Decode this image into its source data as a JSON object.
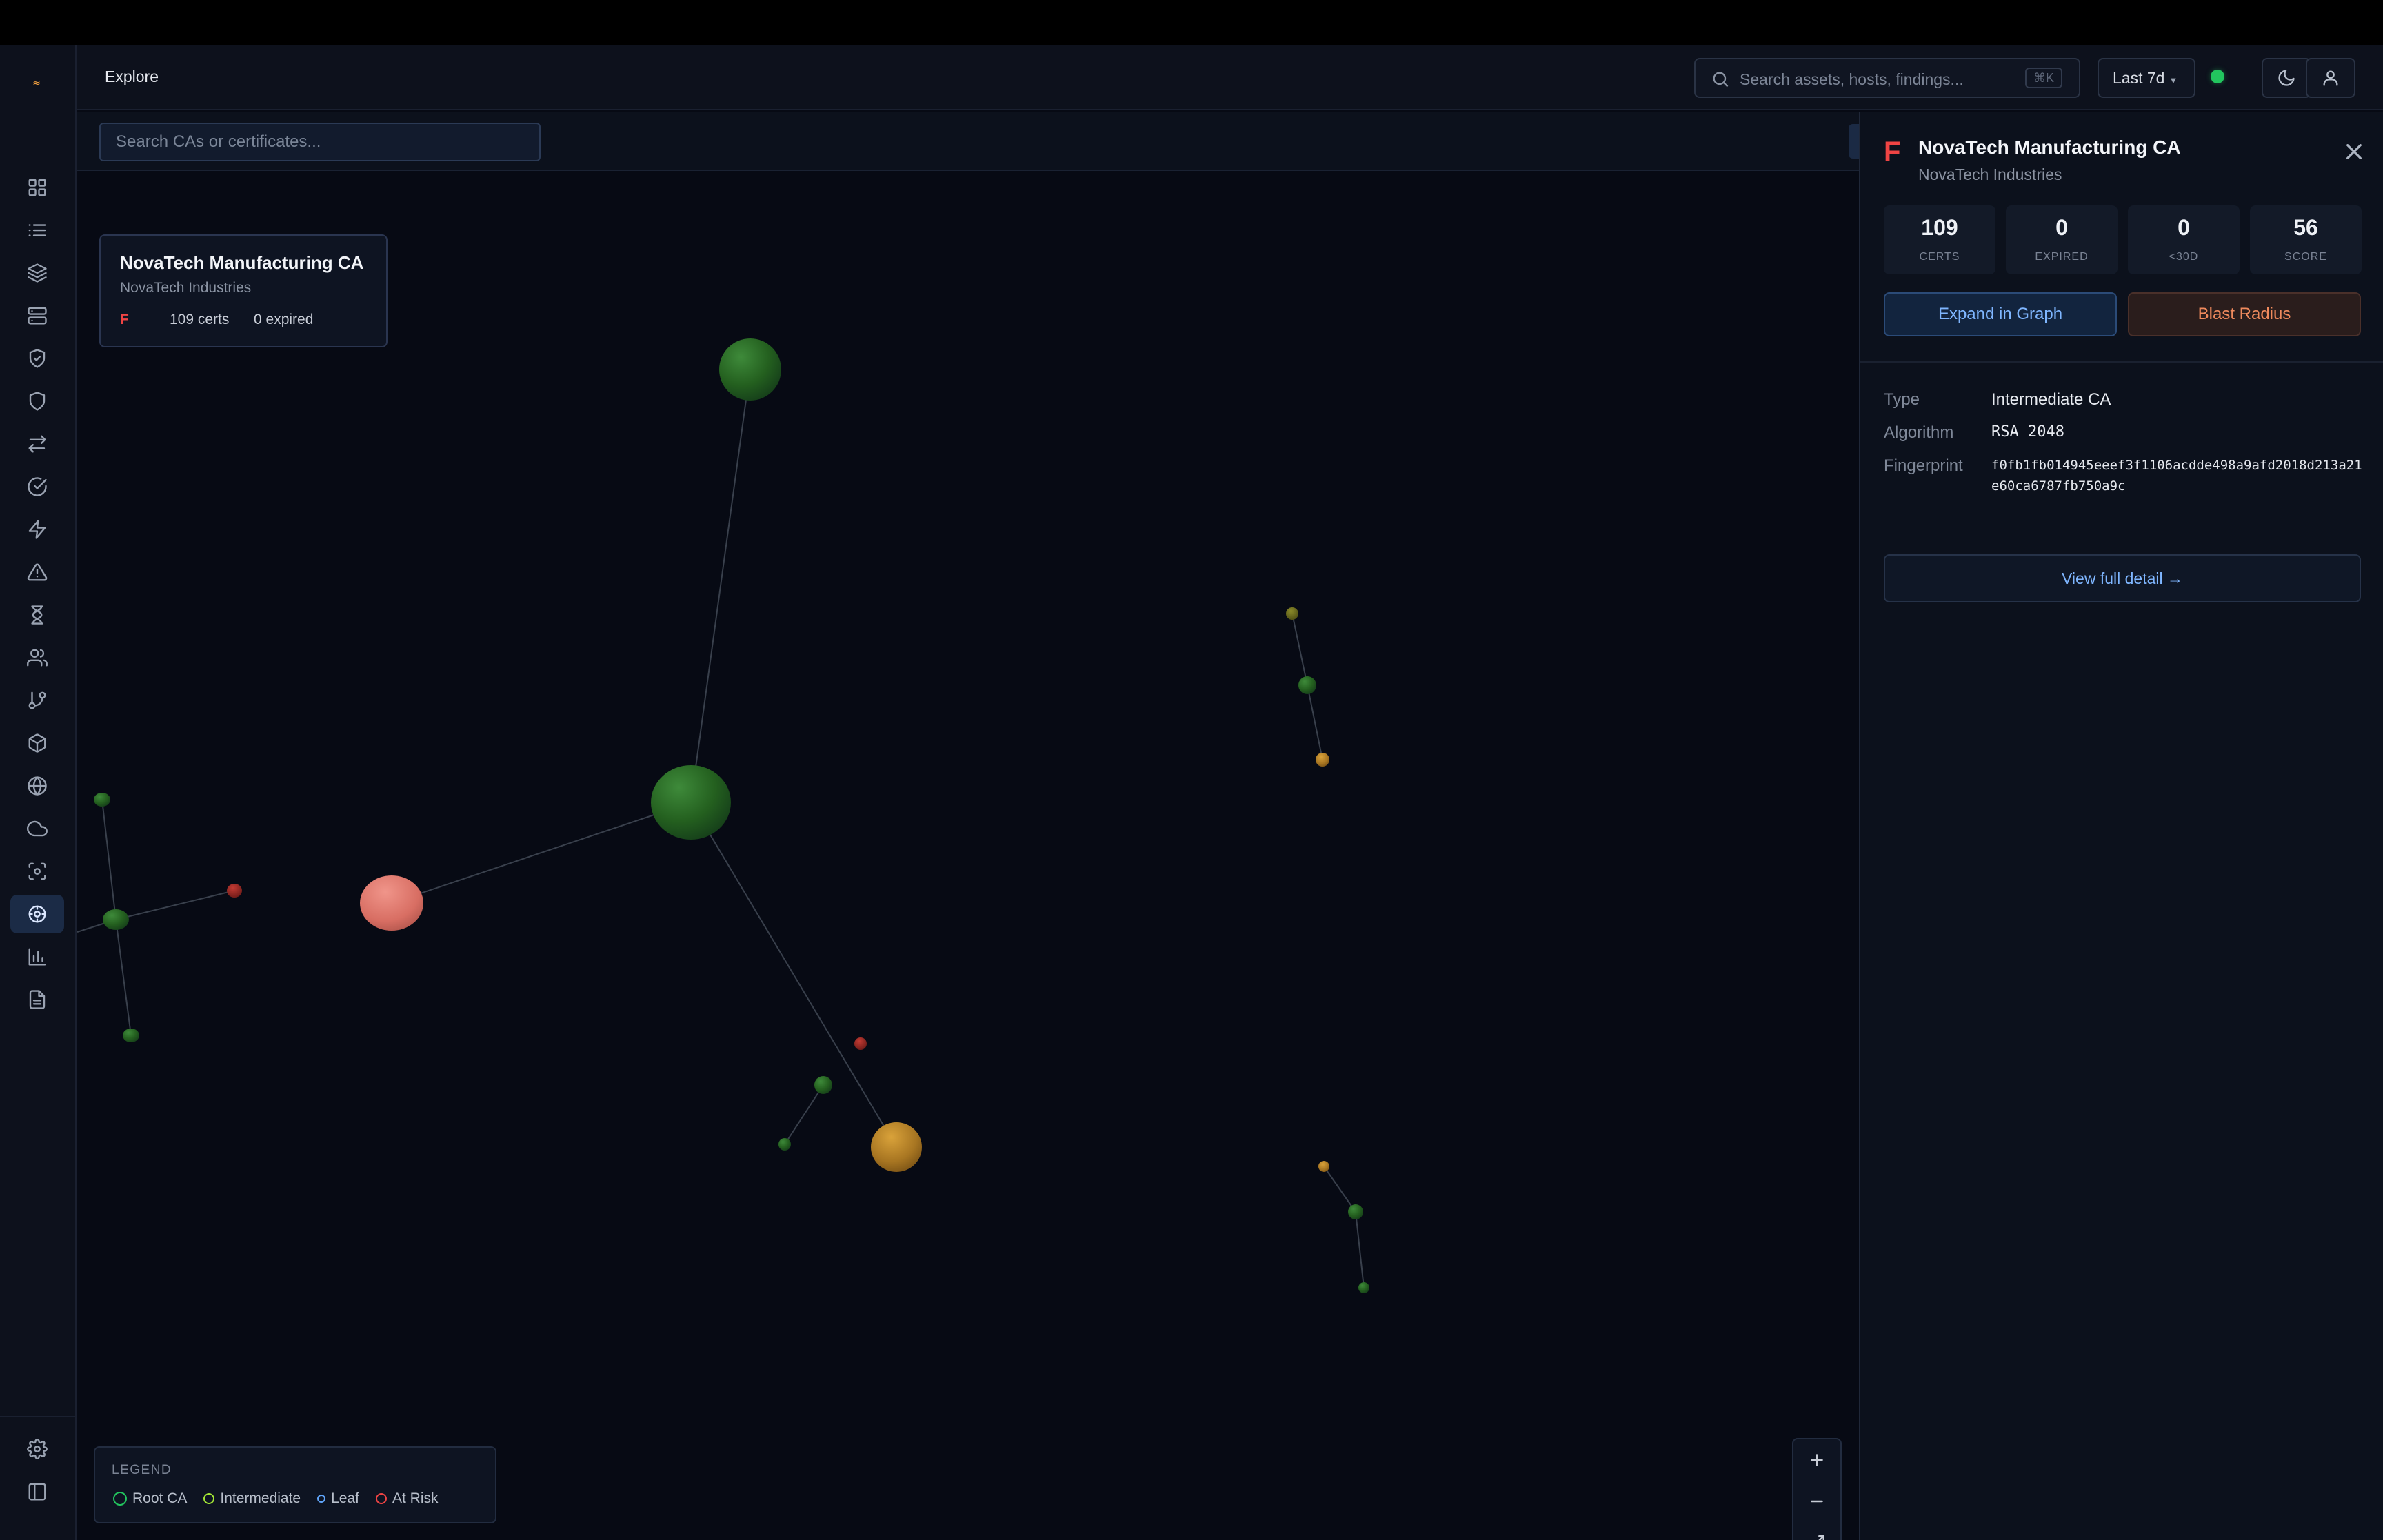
{
  "topbar": {
    "title": "Explore",
    "search_placeholder": "Search assets, hosts, findings...",
    "search_shortcut": "⌘K",
    "time_range": "Last 7d",
    "status_color": "#22c55e"
  },
  "sidebar": {
    "logo": "≈",
    "items": [
      {
        "icon": "dashboard-grid-icon"
      },
      {
        "icon": "list-icon"
      },
      {
        "icon": "layers-icon"
      },
      {
        "icon": "server-icon"
      },
      {
        "icon": "shield-check-icon"
      },
      {
        "icon": "shield-icon"
      },
      {
        "icon": "arrows-swap-icon"
      },
      {
        "icon": "check-circle-icon"
      },
      {
        "icon": "lightning-icon"
      },
      {
        "icon": "warning-triangle-icon"
      },
      {
        "icon": "hourglass-icon"
      },
      {
        "icon": "users-icon"
      },
      {
        "icon": "git-branch-icon"
      },
      {
        "icon": "package-box-icon"
      },
      {
        "icon": "globe-icon"
      },
      {
        "icon": "cloud-icon"
      },
      {
        "icon": "scan-icon"
      },
      {
        "icon": "certificate-graph-icon",
        "active": true
      },
      {
        "icon": "bar-chart-icon"
      },
      {
        "icon": "document-icon"
      }
    ],
    "bottom": [
      {
        "icon": "gear-icon"
      },
      {
        "icon": "sidebar-toggle-icon"
      }
    ]
  },
  "canvas": {
    "search_placeholder": "Search CAs or certificates...",
    "selected": {
      "name": "NovaTech Manufacturing CA",
      "org": "NovaTech Industries",
      "grade": "F",
      "certs": "109 certs",
      "expired": "0 expired"
    },
    "legend": {
      "title": "LEGEND",
      "items": [
        {
          "label": "Root CA",
          "color": "#22c55e"
        },
        {
          "label": "Intermediate",
          "color": "#a3e635"
        },
        {
          "label": "Leaf",
          "color": "#60a5fa"
        },
        {
          "label": "At Risk",
          "color": "#ef4444"
        }
      ]
    },
    "zoom": [
      "zoom-in",
      "zoom-out",
      "fit-screen"
    ]
  },
  "panel": {
    "grade": "F",
    "name": "NovaTech Manufacturing CA",
    "org": "NovaTech Industries",
    "stats": [
      {
        "value": "109",
        "label": "CERTS"
      },
      {
        "value": "0",
        "label": "EXPIRED"
      },
      {
        "value": "0",
        "label": "<30D"
      },
      {
        "value": "56",
        "label": "SCORE"
      }
    ],
    "expand_label": "Expand in Graph",
    "blast_label": "Blast Radius",
    "fields": {
      "type_key": "Type",
      "type_value": "Intermediate CA",
      "algo_key": "Algorithm",
      "algo_value": "RSA 2048",
      "fp_key": "Fingerprint",
      "fp_value": "f0fb1fb014945eeef3f1106acdde498a9afd2018d213a21e60ca6787fb750a9c"
    },
    "detail_link": "View full detail →"
  }
}
